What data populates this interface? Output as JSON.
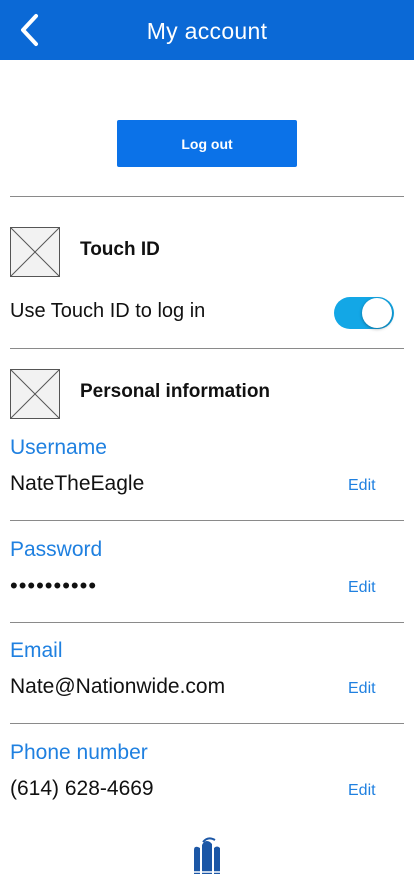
{
  "header": {
    "title": "My account",
    "back_icon": "chevron-left-icon"
  },
  "logout": {
    "label": "Log out"
  },
  "touch_id": {
    "title": "Touch ID",
    "toggle_label": "Use Touch ID to log in",
    "toggle_on": true,
    "icon": "image-placeholder-icon"
  },
  "personal": {
    "title": "Personal information",
    "icon": "image-placeholder-icon",
    "fields": [
      {
        "label": "Username",
        "value": "NateTheEagle",
        "edit": "Edit"
      },
      {
        "label": "Password",
        "value": "••••••••••",
        "edit": "Edit"
      },
      {
        "label": "Email",
        "value": "Nate@Nationwide.com",
        "edit": "Edit"
      },
      {
        "label": "Phone number",
        "value": "(614) 628-4669",
        "edit": "Edit"
      }
    ]
  },
  "footer": {
    "logo": "nationwide-eagle-logo-icon"
  },
  "colors": {
    "header_bg": "#0b69d6",
    "button_bg": "#0b72e8",
    "accent_text": "#1f80e0",
    "toggle_on": "#13a7e6"
  }
}
